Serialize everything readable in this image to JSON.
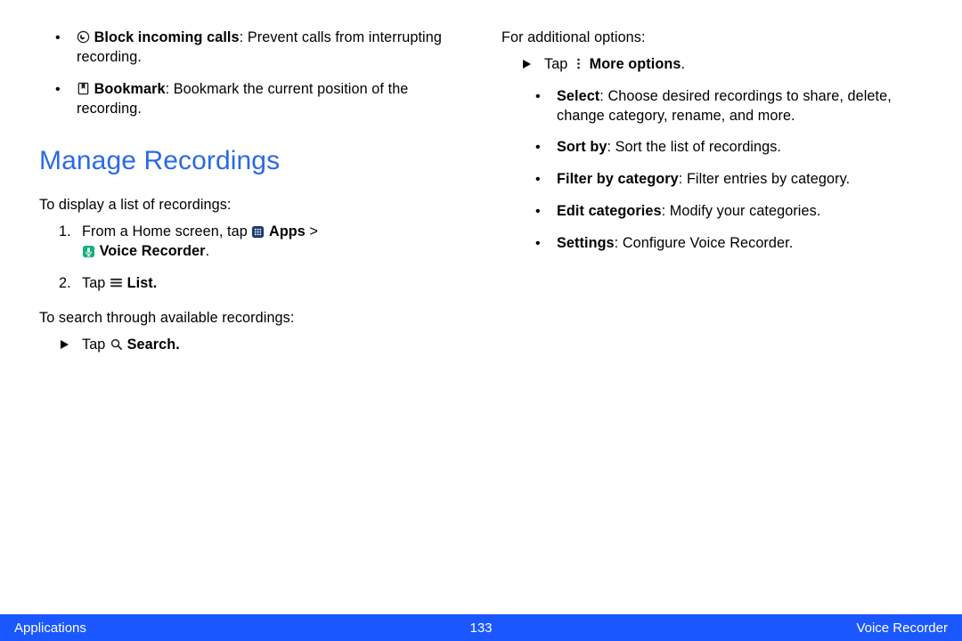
{
  "col_left": {
    "bullets_top": [
      {
        "icon": "block-calls-icon",
        "bold": "Block incoming calls",
        "rest": ": Prevent calls from interrupting recording."
      },
      {
        "icon": "bookmark-icon",
        "bold": "Bookmark",
        "rest": ": Bookmark the current position of the recording."
      }
    ],
    "heading": "Manage Recordings",
    "intro1": "To display a list of recordings:",
    "step1_a": "From a Home screen, tap ",
    "step1_apps": "Apps",
    "step1_gt": " > ",
    "step1_vr": "Voice Recorder",
    "step1_period": ".",
    "step2_tap": "Tap ",
    "step2_list": "List.",
    "intro2": "To search through available recordings:",
    "arrow1_tap": "Tap ",
    "arrow1_search": "Search."
  },
  "col_right": {
    "intro": "For additional options:",
    "arrow_tap": "Tap ",
    "arrow_more": "More options",
    "arrow_period": ".",
    "options": [
      {
        "bold": "Select",
        "rest": ": Choose desired recordings to share, delete, change category, rename, and more."
      },
      {
        "bold": "Sort by",
        "rest": ": Sort the list of recordings."
      },
      {
        "bold": "Filter by category",
        "rest": ": Filter entries by category."
      },
      {
        "bold": "Edit categories",
        "rest": ": Modify your categories."
      },
      {
        "bold": "Settings",
        "rest": ": Configure Voice Recorder."
      }
    ]
  },
  "footer": {
    "left": "Applications",
    "center": "133",
    "right": "Voice Recorder"
  },
  "numbers": {
    "one": "1.",
    "two": "2."
  }
}
